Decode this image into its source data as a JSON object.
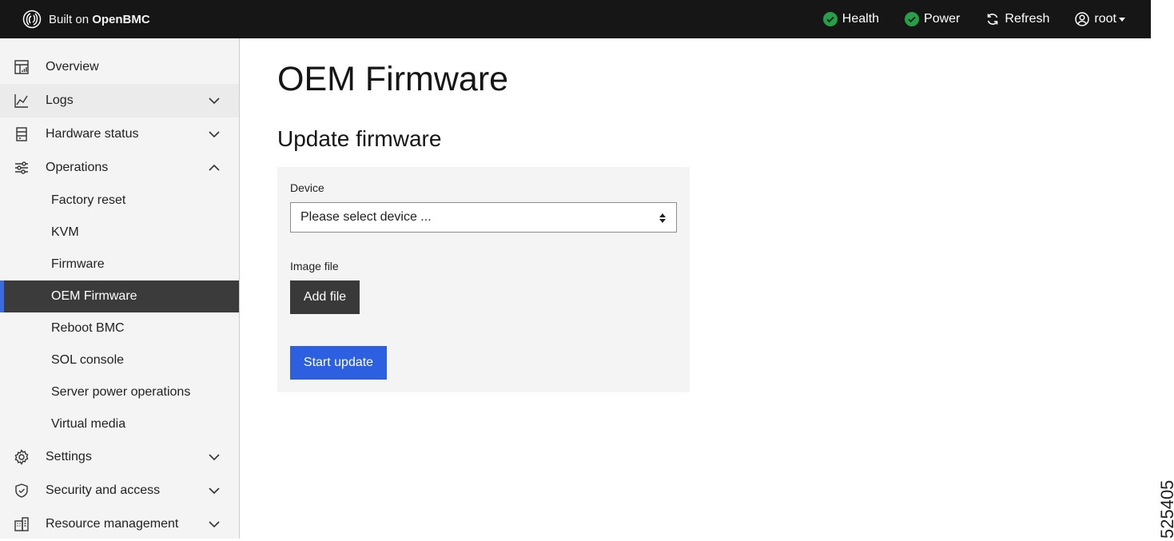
{
  "header": {
    "brand_prefix": "Built on",
    "brand_name": "OpenBMC",
    "health_label": "Health",
    "power_label": "Power",
    "refresh_label": "Refresh",
    "user_label": "root",
    "status_color": "#24a148"
  },
  "sidebar": {
    "items": [
      {
        "label": "Overview",
        "icon": "dashboard-icon"
      },
      {
        "label": "Logs",
        "icon": "chart-line-icon"
      },
      {
        "label": "Hardware status",
        "icon": "data-base-icon"
      },
      {
        "label": "Operations",
        "icon": "settings-adjust-icon"
      },
      {
        "label": "Settings",
        "icon": "gear-icon"
      },
      {
        "label": "Security and access",
        "icon": "shield-icon"
      },
      {
        "label": "Resource management",
        "icon": "building-icon"
      }
    ],
    "operations_sub": [
      "Factory reset",
      "KVM",
      "Firmware",
      "OEM Firmware",
      "Reboot BMC",
      "SOL console",
      "Server power operations",
      "Virtual media"
    ],
    "active_item": "OEM Firmware",
    "active_accent": "#3a6ae0"
  },
  "main": {
    "page_title": "OEM Firmware",
    "section_title": "Update firmware",
    "device_label": "Device",
    "device_selected": "Please select device ...",
    "image_file_label": "Image file",
    "add_file_label": "Add file",
    "start_update_label": "Start update",
    "primary_color": "#2d60e0"
  },
  "side_id": "525405"
}
